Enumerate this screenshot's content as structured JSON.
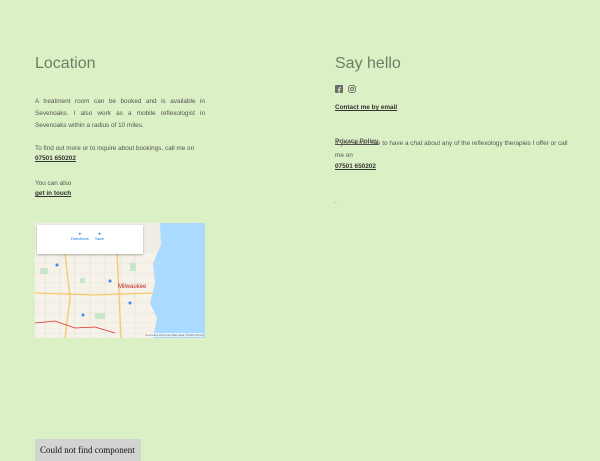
{
  "location": {
    "heading": "Location",
    "paragraph1": "A treatment room can be booked and is available in Sevenoaks. I also work as a mobile reflexologist in Sevenoaks within a radius of 10 miles.",
    "paragraph2": "To find out more or to inquire about bookings, call me on",
    "phone": "07501 650202",
    "paragraph3": "You can also",
    "get_in_touch": "get in touch"
  },
  "map": {
    "city_label": "Milwaukee",
    "directions_label": "Directions",
    "save_label": "Save",
    "attribution": "Keyboard shortcuts  Map data ©2024  Terms"
  },
  "say_hello": {
    "heading": "Say hello",
    "social_icons": [
      "facebook-icon",
      "instagram-icon"
    ],
    "contact_link": "Contact me by email",
    "privacy_policy": "Privacy Policy",
    "paragraph": "If you would like to have a chat about any of the reflexology therapies I offer or call me on",
    "phone": "07501 650202",
    "trailing_dot": "."
  },
  "error_message": "Could not find component",
  "colors": {
    "background": "#dcf0c5",
    "heading": "#6f7d63",
    "error_background": "#d3d3d3"
  }
}
